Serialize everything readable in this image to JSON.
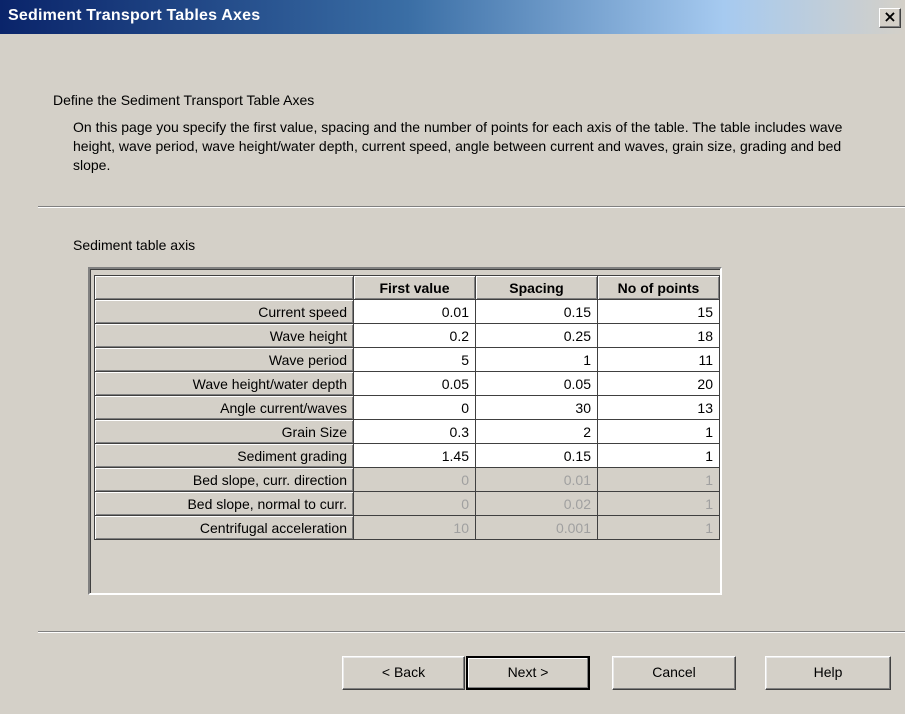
{
  "window": {
    "title": "Sediment Transport Tables Axes",
    "close_glyph": "×"
  },
  "page": {
    "heading": "Define the Sediment Transport Table Axes",
    "description": "On this page you specify the first value, spacing and the number of points for each axis of the table. The table includes wave height, wave period, wave height/water depth, current speed, angle between current and waves, grain size, grading and  bed slope.",
    "table_label": "Sediment table axis"
  },
  "table": {
    "columns": [
      "",
      "First value",
      "Spacing",
      "No of points"
    ],
    "rows": [
      {
        "label": "Current speed",
        "first": "0.01",
        "spacing": "0.15",
        "points": "15",
        "enabled": true
      },
      {
        "label": "Wave height",
        "first": "0.2",
        "spacing": "0.25",
        "points": "18",
        "enabled": true
      },
      {
        "label": "Wave period",
        "first": "5",
        "spacing": "1",
        "points": "11",
        "enabled": true
      },
      {
        "label": "Wave height/water depth",
        "first": "0.05",
        "spacing": "0.05",
        "points": "20",
        "enabled": true
      },
      {
        "label": "Angle current/waves",
        "first": "0",
        "spacing": "30",
        "points": "13",
        "enabled": true
      },
      {
        "label": "Grain Size",
        "first": "0.3",
        "spacing": "2",
        "points": "1",
        "enabled": true
      },
      {
        "label": "Sediment grading",
        "first": "1.45",
        "spacing": "0.15",
        "points": "1",
        "enabled": true
      },
      {
        "label": "Bed slope, curr. direction",
        "first": "0",
        "spacing": "0.01",
        "points": "1",
        "enabled": false
      },
      {
        "label": "Bed slope, normal to curr.",
        "first": "0",
        "spacing": "0.02",
        "points": "1",
        "enabled": false
      },
      {
        "label": "Centrifugal acceleration",
        "first": "10",
        "spacing": "0.001",
        "points": "1",
        "enabled": false
      }
    ]
  },
  "buttons": {
    "back": "< Back",
    "next": "Next >",
    "cancel": "Cancel",
    "help": "Help"
  },
  "colors": {
    "dialog_bg": "#d4d0c8",
    "titlebar_start": "#0a246a",
    "titlebar_end": "#a6caf0",
    "disabled_text": "#a0a0a0"
  }
}
